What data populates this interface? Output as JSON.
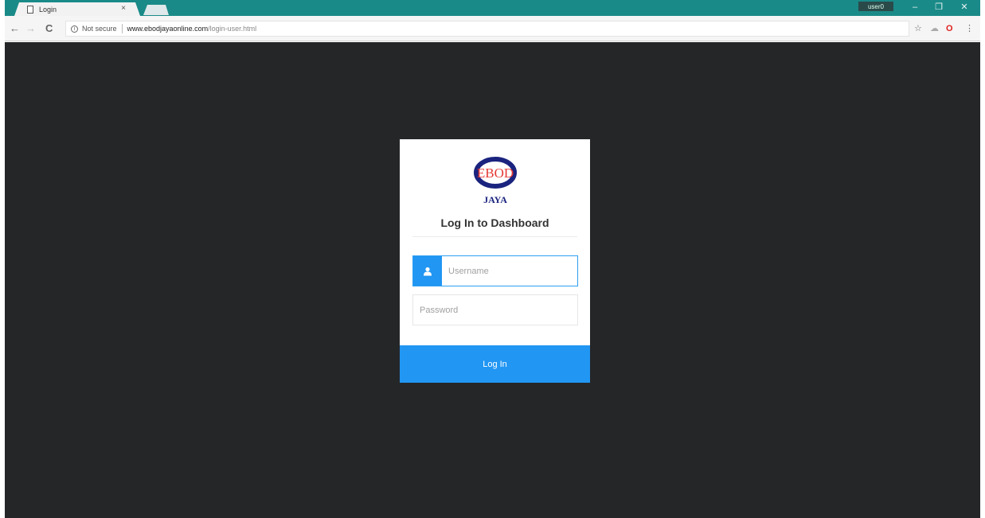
{
  "browser": {
    "tab_title": "Login",
    "tab_close": "×",
    "profile_name": "user0",
    "window_controls": {
      "minimize": "–",
      "restore": "❐",
      "close": "✕"
    },
    "nav": {
      "back": "←",
      "forward": "→",
      "reload": "C"
    },
    "security_label": "Not secure",
    "url_host": "www.ebodjayaonline.com",
    "url_path": "/login-user.html",
    "toolbar_icons": {
      "bookmark": "☆",
      "extension": "☁",
      "opera": "O",
      "menu": "⋮"
    }
  },
  "login": {
    "logo_text_top": "EBOD",
    "logo_text_bottom": "JAYA",
    "title": "Log In to Dashboard",
    "username_placeholder": "Username",
    "username_value": "",
    "password_placeholder": "Password",
    "password_value": "",
    "submit_label": "Log In"
  },
  "colors": {
    "tabstrip": "#1a8a88",
    "page_background": "#252628",
    "accent": "#2196f3",
    "logo_red": "#e53935",
    "logo_navy": "#1a237e"
  }
}
